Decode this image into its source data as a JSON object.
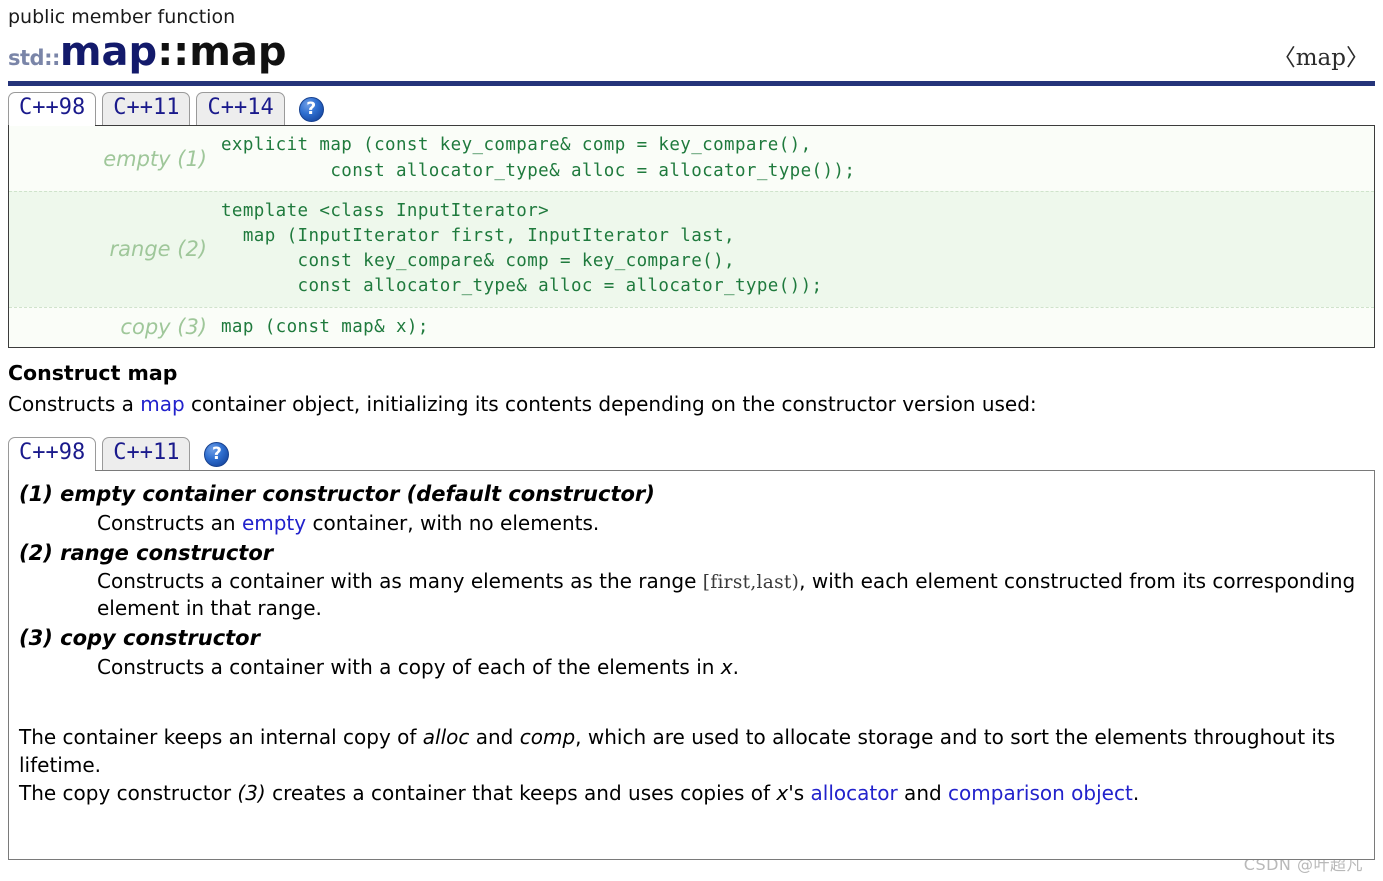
{
  "header": {
    "kicker": "public member function",
    "namespace": "std::",
    "class_name": "map",
    "separator": "::",
    "member_name": "map",
    "include_tag": "〈map〉",
    "rule_color": "#25347a"
  },
  "prototype_tabs": {
    "items": [
      {
        "label": "C++98",
        "active": true
      },
      {
        "label": "C++11",
        "active": false
      },
      {
        "label": "C++14",
        "active": false
      }
    ],
    "help_icon": "?"
  },
  "prototypes": {
    "rows": [
      {
        "label": "empty (1)",
        "code": "explicit map (const key_compare& comp = key_compare(),\n          const allocator_type& alloc = allocator_type());"
      },
      {
        "label": "range (2)",
        "code": "template <class InputIterator>\n  map (InputIterator first, InputIterator last,\n       const key_compare& comp = key_compare(),\n       const allocator_type& alloc = allocator_type());"
      },
      {
        "label": "copy (3)",
        "code": "map (const map& x);"
      }
    ]
  },
  "section": {
    "heading": "Construct map",
    "lead_before": "Constructs a ",
    "lead_link": "map",
    "lead_after": " container object, initializing its contents depending on the constructor version used:"
  },
  "description_tabs": {
    "items": [
      {
        "label": "C++98",
        "active": true
      },
      {
        "label": "C++11",
        "active": false
      }
    ],
    "help_icon": "?"
  },
  "descriptions": [
    {
      "term": "(1) empty container constructor (default constructor)",
      "def_before": "Constructs an ",
      "def_link": "empty",
      "def_after": " container, with no elements."
    },
    {
      "term": "(2) range constructor",
      "def_before": "Constructs a container with as many elements as the range ",
      "def_mono": "[first,last)",
      "def_after": ", with each element constructed from its corresponding element in that range."
    },
    {
      "term": "(3) copy constructor",
      "def_before": "Constructs a container with a copy of each of the elements in ",
      "def_italic": "x",
      "def_after": "."
    }
  ],
  "tail": {
    "line1_a": "The container keeps an internal copy of ",
    "line1_i1": "alloc",
    "line1_b": " and ",
    "line1_i2": "comp",
    "line1_c": ", which are used to allocate storage and to sort the elements throughout its lifetime.",
    "line2_a": "The copy constructor ",
    "line2_i1": "(3)",
    "line2_b": " creates a container that keeps and uses copies of ",
    "line2_i2": "x",
    "line2_c": "'s ",
    "line2_link1": "allocator",
    "line2_d": " and ",
    "line2_link2": "comparison object",
    "line2_e": "."
  },
  "watermark": "CSDN @叶超凡"
}
